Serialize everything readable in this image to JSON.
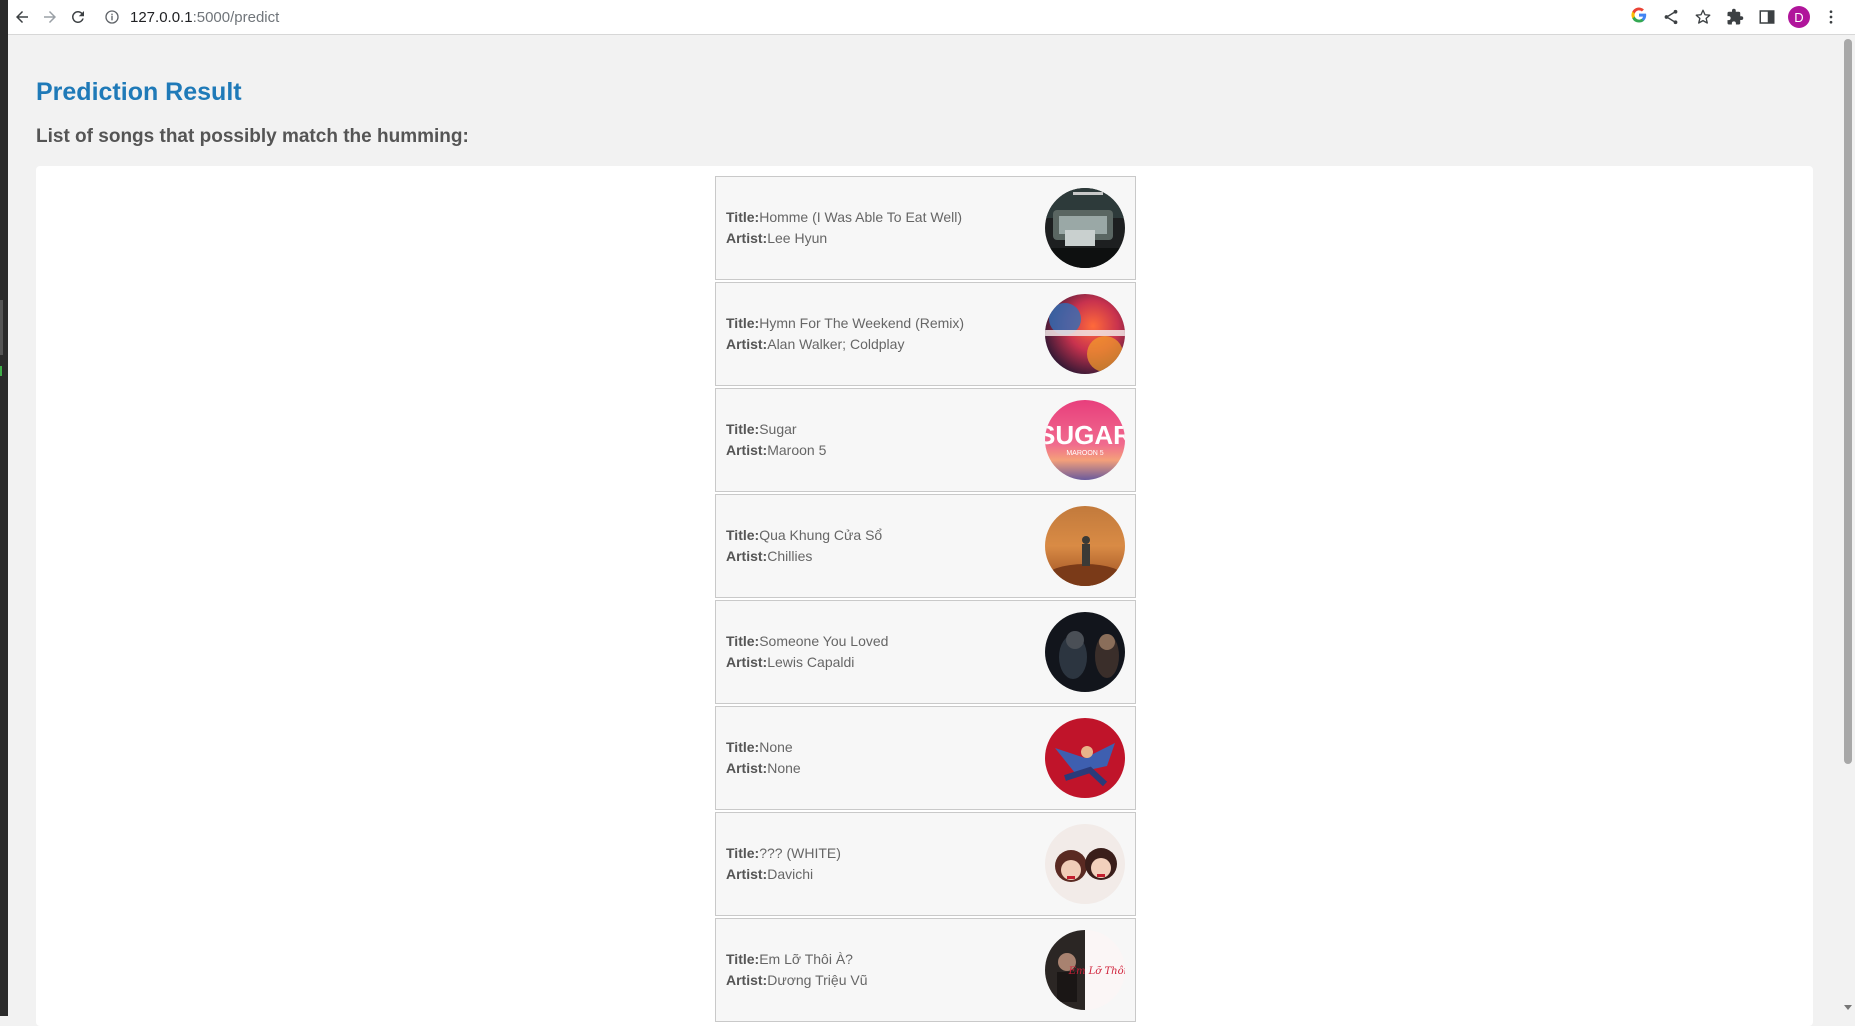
{
  "browser": {
    "url_host": "127.0.0.1",
    "url_path": ":5000/predict",
    "profile_initial": "D",
    "google_logo": "G"
  },
  "page": {
    "title": "Prediction Result",
    "subtitle": "List of songs that possibly match the humming:"
  },
  "labels": {
    "title": "Title:",
    "artist": "Artist:"
  },
  "songs": [
    {
      "title": "Homme (I Was Able To Eat Well)",
      "artist": "Lee Hyun",
      "cover": "dark-car-photo"
    },
    {
      "title": "Hymn For The Weekend (Remix)",
      "artist": "Alan Walker; Coldplay",
      "cover": "colorful-smoke"
    },
    {
      "title": "Sugar",
      "artist": "Maroon 5",
      "cover": "sugar-pink"
    },
    {
      "title": "Qua Khung Cửa Sổ",
      "artist": "Chillies",
      "cover": "desert-figure"
    },
    {
      "title": "Someone You Loved",
      "artist": "Lewis Capaldi",
      "cover": "dark-portrait"
    },
    {
      "title": "None",
      "artist": "None",
      "cover": "red-dancer"
    },
    {
      "title": "??? (WHITE)",
      "artist": "Davichi",
      "cover": "duo-portrait"
    },
    {
      "title": "Em Lỡ Thôi À?",
      "artist": "Dương Triệu Vũ",
      "cover": "split-portrait"
    }
  ],
  "cover_text": {
    "sugar_title": "SUGAR",
    "sugar_sub": "MAROON 5",
    "em_lo_script": "Em Lỡ Thôi à?"
  }
}
